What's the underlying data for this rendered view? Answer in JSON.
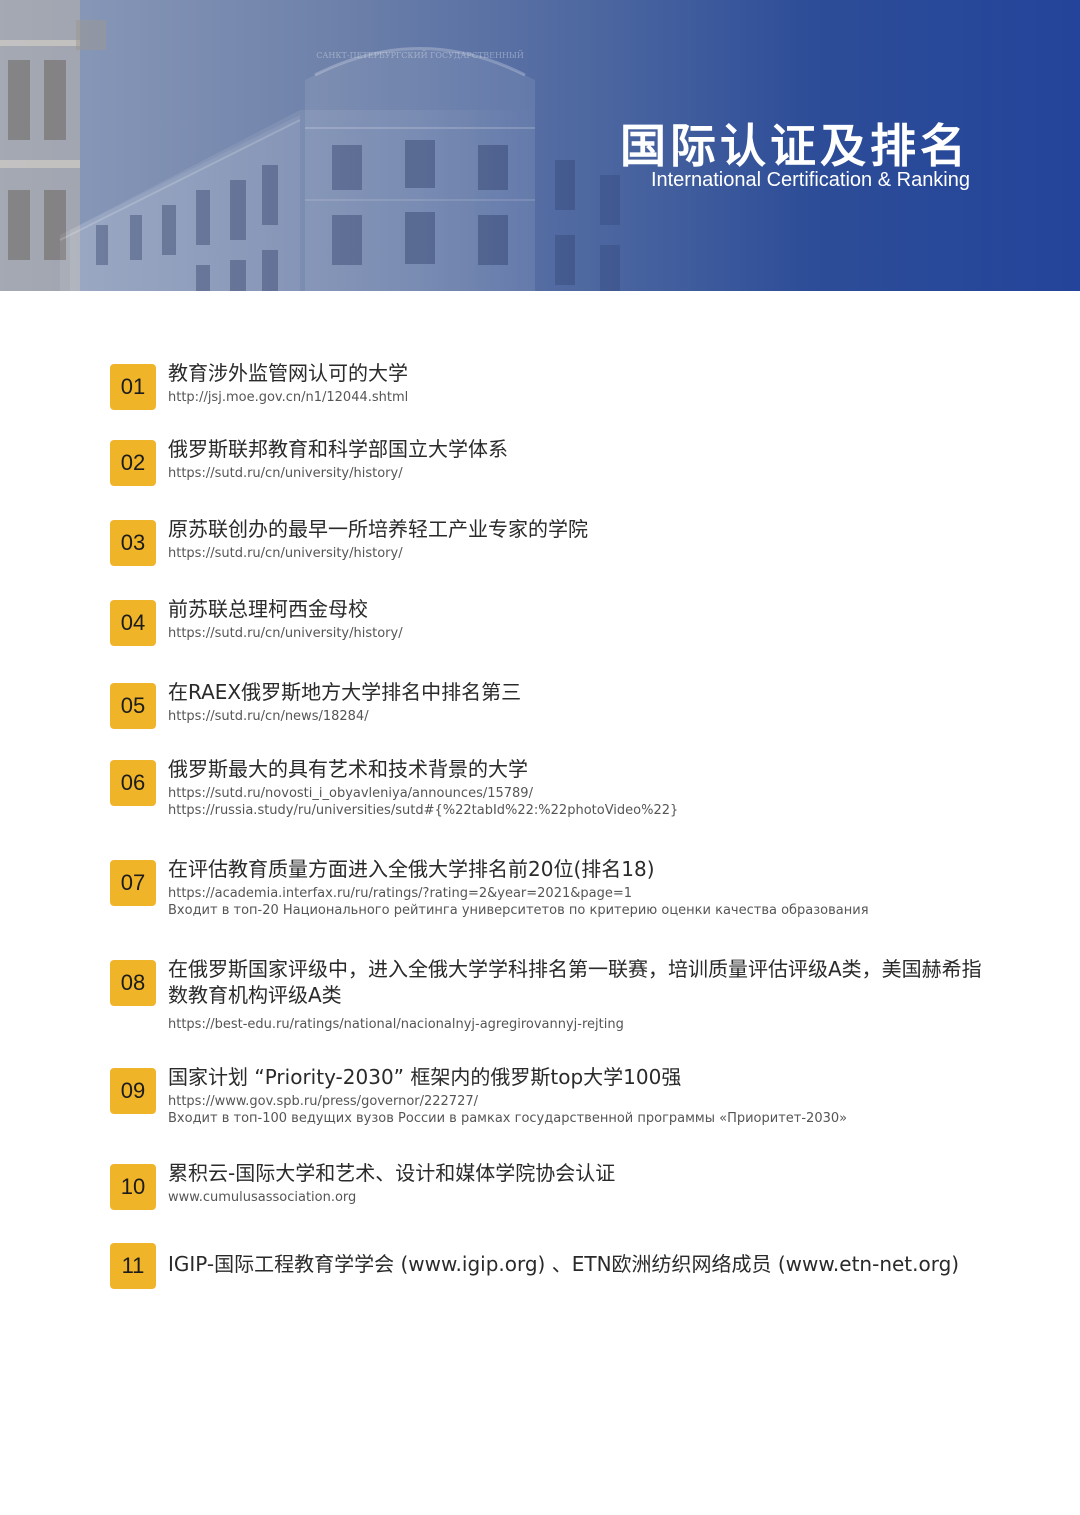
{
  "header": {
    "title": "国际认证及排名",
    "subtitle": "International Certification & Ranking",
    "building_sign": "САНКТ-ПЕТЕРБУРГСКИЙ ГОСУДАРСТВЕННЫЙ"
  },
  "colors": {
    "header_blue": "#23449a",
    "badge_yellow": "#f0b429",
    "title_text": "#2a2a2a",
    "link_text": "#555555"
  },
  "items": [
    {
      "number": "01",
      "title": "教育涉外监管网认可的大学",
      "links": [
        "http://jsj.moe.gov.cn/n1/12044.shtml"
      ]
    },
    {
      "number": "02",
      "title": "俄罗斯联邦教育和科学部国立大学体系",
      "links": [
        "https://sutd.ru/cn/university/history/"
      ]
    },
    {
      "number": "03",
      "title": "原苏联创办的最早一所培养轻工产业专家的学院",
      "links": [
        "https://sutd.ru/cn/university/history/"
      ]
    },
    {
      "number": "04",
      "title": "前苏联总理柯西金母校",
      "links": [
        "https://sutd.ru/cn/university/history/"
      ]
    },
    {
      "number": "05",
      "title": "在RAEX俄罗斯地方大学排名中排名第三",
      "links": [
        "https://sutd.ru/cn/news/18284/"
      ]
    },
    {
      "number": "06",
      "title": "俄罗斯最大的具有艺术和技术背景的大学",
      "links": [
        "https://sutd.ru/novosti_i_obyavleniya/announces/15789/",
        "https://russia.study/ru/universities/sutd#{%22tabId%22:%22photoVideo%22}"
      ]
    },
    {
      "number": "07",
      "title": "在评估教育质量方面进入全俄大学排名前20位(排名18)",
      "links": [
        "https://academia.interfax.ru/ru/ratings/?rating=2&year=2021&page=1",
        "Входит в топ-20 Национального рейтинга университетов по критерию оценки качества образования"
      ]
    },
    {
      "number": "08",
      "title": "在俄罗斯国家评级中，进入全俄大学学科排名第一联赛，培训质量评估评级A类，美国赫希指数教育机构评级A类",
      "links": [
        "https://best-edu.ru/ratings/national/nacionalnyj-agregirovannyj-rejting"
      ]
    },
    {
      "number": "09",
      "title": "国家计划 “Priority-2030” 框架内的俄罗斯top大学100强",
      "links": [
        "https://www.gov.spb.ru/press/governor/222727/",
        "Входит в топ-100 ведущих вузов России в рамках государственной программы «Приоритет-2030»"
      ]
    },
    {
      "number": "10",
      "title": "累积云-国际大学和艺术、设计和媒体学院协会认证",
      "links": [
        "www.cumulusassociation.org"
      ]
    },
    {
      "number": "11",
      "title": "IGIP-国际工程教育学学会 (www.igip.org) 、ETN欧洲纺织网络成员 (www.etn-net.org)",
      "links": []
    }
  ]
}
